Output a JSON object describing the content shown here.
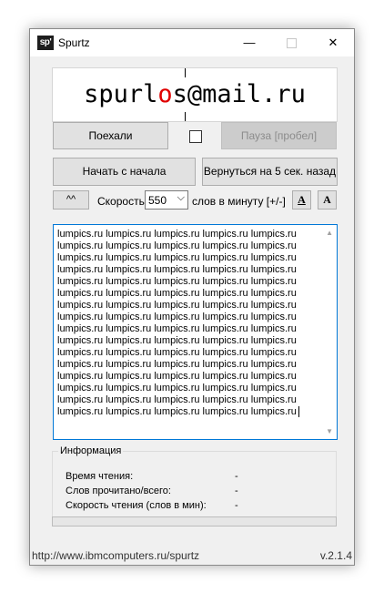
{
  "window": {
    "icon_text": "sp'",
    "title": "Spurtz",
    "minimize_glyph": "—",
    "close_glyph": "✕"
  },
  "reader": {
    "word_before": "spurl",
    "word_focus": "o",
    "word_after": "s@mail.ru"
  },
  "controls": {
    "go_label": "Поехали",
    "pause_label": "Пауза [пробел]",
    "pause_enabled": false,
    "checkbox_checked": false,
    "restart_label": "Начать с начала",
    "back_label": "Вернуться на 5 сек. назад",
    "up_label": "^^",
    "speed_label": "Скорость",
    "speed_value": "550",
    "wpm_label": "слов в минуту [+/-]",
    "font_smaller_label": "A",
    "font_larger_label": "A"
  },
  "text": {
    "lines": [
      "lumpics.ru lumpics.ru lumpics.ru lumpics.ru lumpics.ru",
      "lumpics.ru lumpics.ru lumpics.ru lumpics.ru lumpics.ru",
      "lumpics.ru lumpics.ru lumpics.ru lumpics.ru lumpics.ru",
      "lumpics.ru lumpics.ru lumpics.ru lumpics.ru lumpics.ru",
      "lumpics.ru lumpics.ru lumpics.ru lumpics.ru lumpics.ru",
      "lumpics.ru lumpics.ru lumpics.ru lumpics.ru lumpics.ru",
      "lumpics.ru lumpics.ru lumpics.ru lumpics.ru lumpics.ru",
      "lumpics.ru lumpics.ru lumpics.ru lumpics.ru lumpics.ru",
      "lumpics.ru lumpics.ru lumpics.ru lumpics.ru lumpics.ru",
      "lumpics.ru lumpics.ru lumpics.ru lumpics.ru lumpics.ru",
      "lumpics.ru lumpics.ru lumpics.ru lumpics.ru lumpics.ru",
      "lumpics.ru lumpics.ru lumpics.ru lumpics.ru lumpics.ru",
      "lumpics.ru lumpics.ru lumpics.ru lumpics.ru lumpics.ru",
      "lumpics.ru lumpics.ru lumpics.ru lumpics.ru lumpics.ru",
      "lumpics.ru lumpics.ru lumpics.ru lumpics.ru lumpics.ru",
      "lumpics.ru lumpics.ru lumpics.ru lumpics.ru lumpics.ru"
    ]
  },
  "info": {
    "title": "Информация",
    "reading_time_label": "Время чтения:",
    "reading_time_value": "-",
    "words_label": "Слов прочитано/всего:",
    "words_value": "-",
    "speed_label": "Скорость чтения (слов в мин):",
    "speed_value": "-"
  },
  "progress": {
    "fraction": 0
  },
  "status": {
    "url": "http://www.ibmcomputers.ru/spurtz",
    "version": "v.2.1.4"
  },
  "colors": {
    "focus_letter": "#e00000",
    "textarea_border": "#0078d7"
  },
  "icons": {
    "app": "spurtz-logo-icon",
    "minimize": "minimize-icon",
    "maximize": "maximize-icon",
    "close": "close-icon",
    "dropdown": "chevron-down-icon"
  }
}
